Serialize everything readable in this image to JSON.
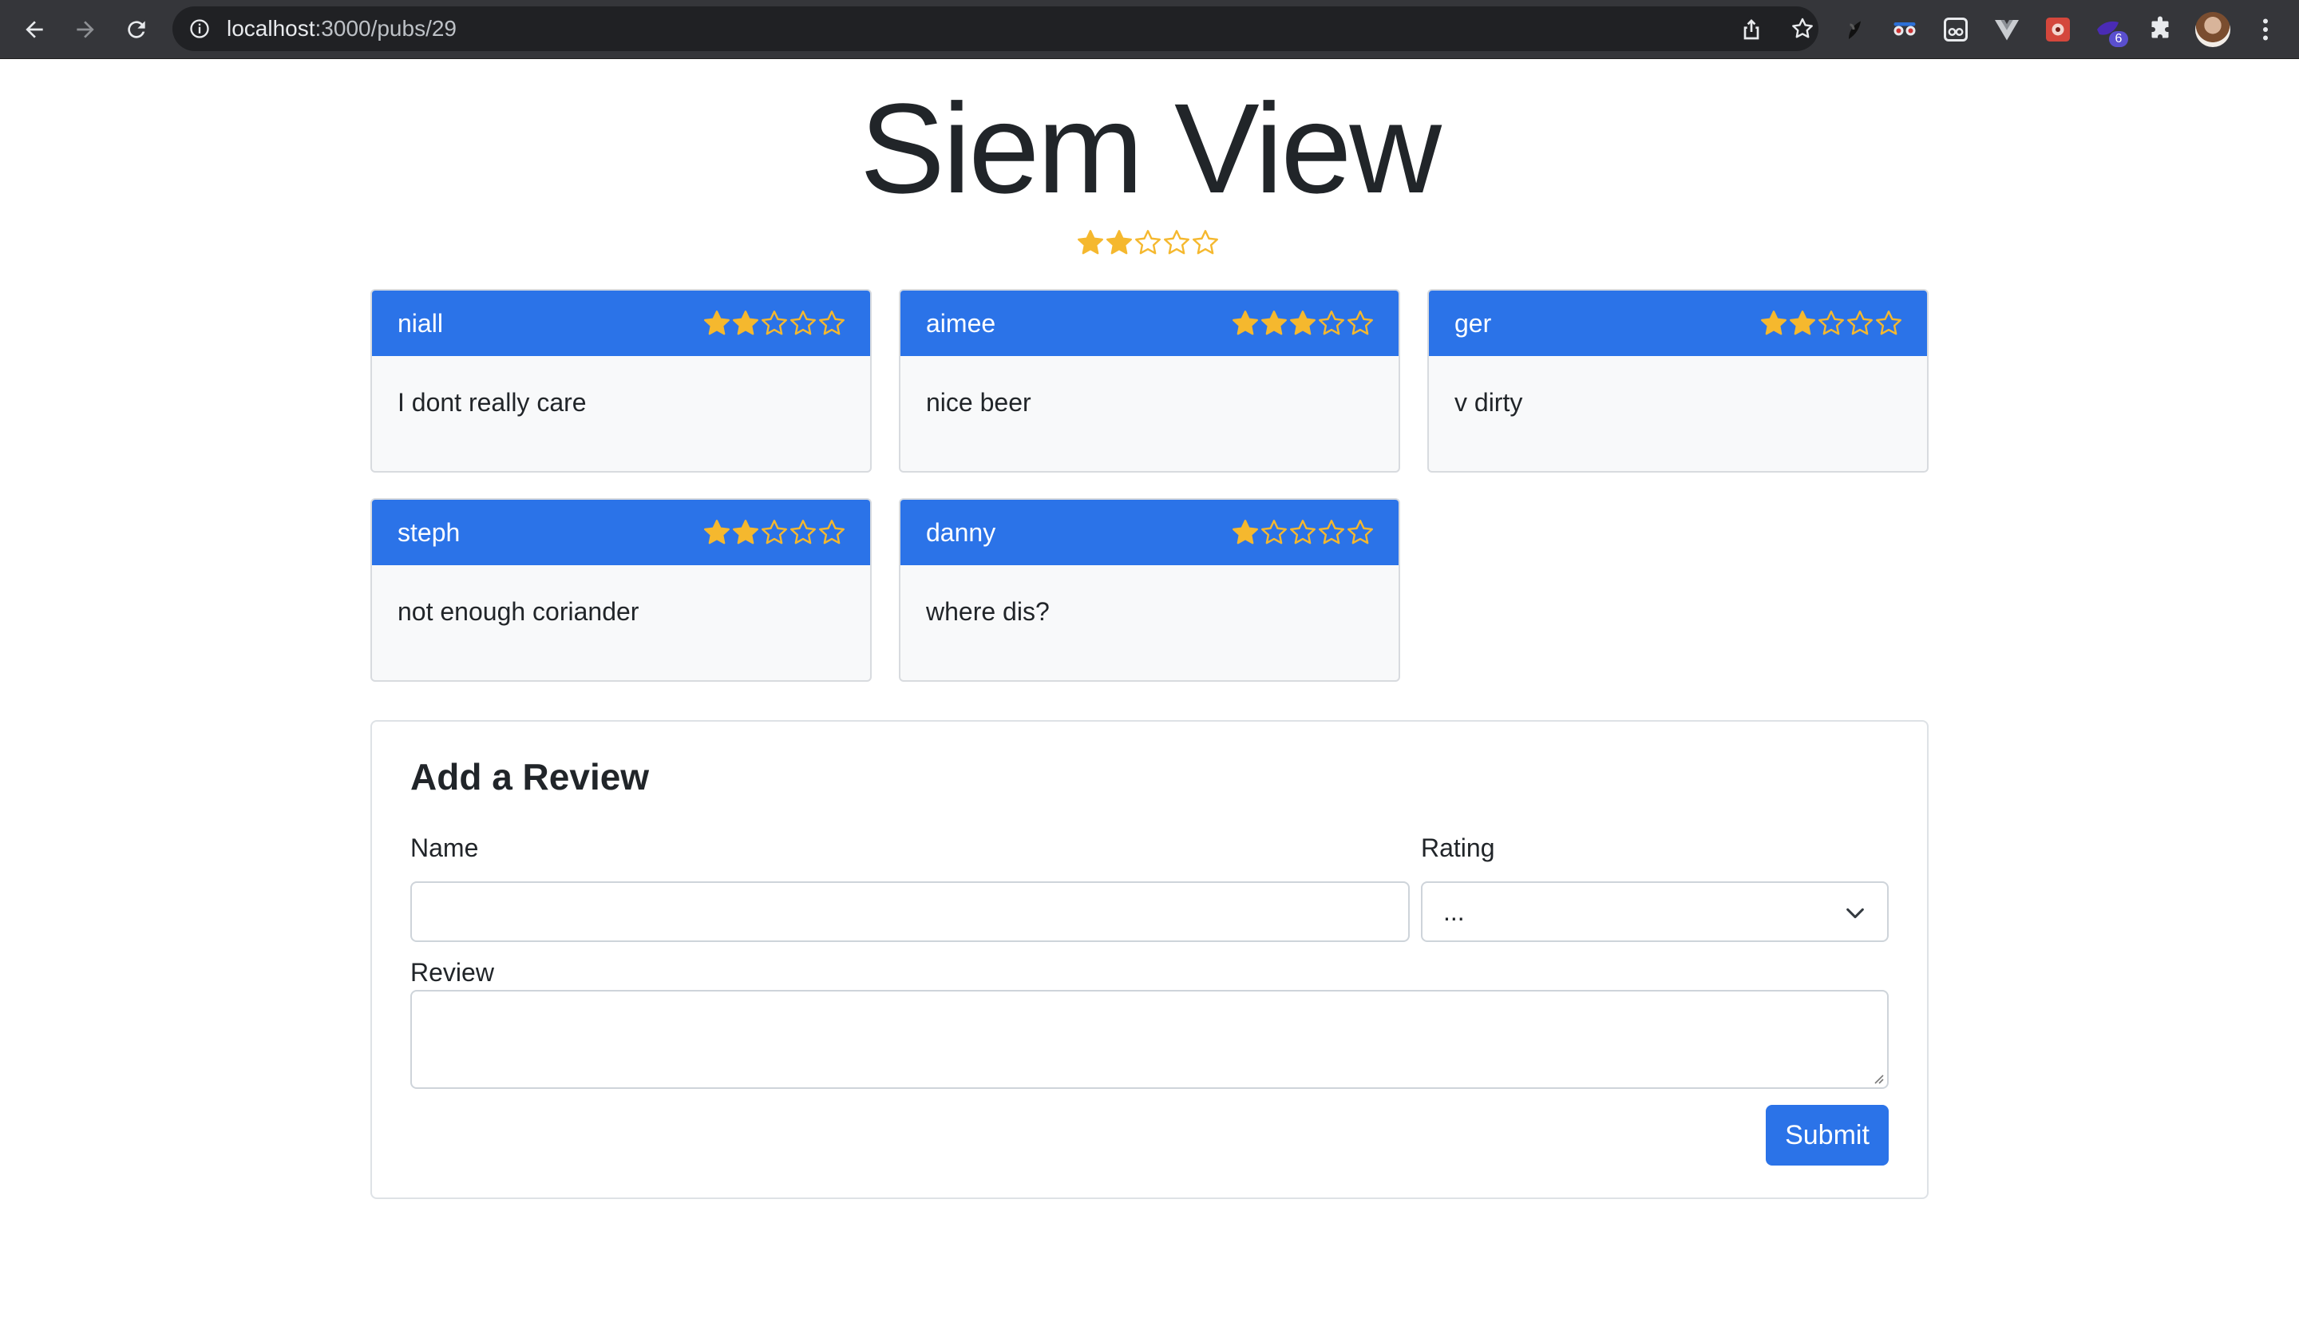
{
  "browser": {
    "url_host": "localhost",
    "url_rest": ":3000/pubs/29",
    "extension_badge": "6"
  },
  "pub": {
    "name": "Siem View",
    "rating": 2,
    "max_rating": 5
  },
  "reviews": [
    {
      "name": "niall",
      "rating": 2,
      "text": "I dont really care"
    },
    {
      "name": "aimee",
      "rating": 3,
      "text": "nice beer"
    },
    {
      "name": "ger",
      "rating": 2,
      "text": "v dirty"
    },
    {
      "name": "steph",
      "rating": 2,
      "text": "not enough coriander"
    },
    {
      "name": "danny",
      "rating": 1,
      "text": "where dis?"
    }
  ],
  "form": {
    "title": "Add a Review",
    "name_label": "Name",
    "name_value": "",
    "rating_label": "Rating",
    "rating_selected": "...",
    "review_label": "Review",
    "review_value": "",
    "submit_label": "Submit"
  },
  "colors": {
    "primary": "#2b73e8",
    "star": "#f5b82e",
    "card_body": "#f8f9fa"
  }
}
